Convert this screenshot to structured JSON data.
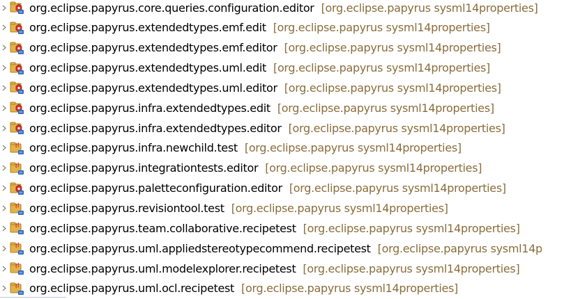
{
  "colors": {
    "name": "#000000",
    "decoration": "#8a6d3b",
    "twisty": "#808080",
    "folder": "#e2b24a",
    "folder_dark": "#b07d1c",
    "badge": "#2c62b8",
    "badge_light": "#6aa0e6",
    "plugin_red": "#d9342b"
  },
  "tree": {
    "items": [
      {
        "name": "org.eclipse.papyrus.core.queries.configuration.editor",
        "decoration": "[org.eclipse.papyrus sysml14properties]",
        "icon": "plugin-project-icon"
      },
      {
        "name": "org.eclipse.papyrus.extendedtypes.emf.edit",
        "decoration": "[org.eclipse.papyrus sysml14properties]",
        "icon": "plugin-project-icon"
      },
      {
        "name": "org.eclipse.papyrus.extendedtypes.emf.editor",
        "decoration": "[org.eclipse.papyrus sysml14properties]",
        "icon": "plugin-project-icon"
      },
      {
        "name": "org.eclipse.papyrus.extendedtypes.uml.edit",
        "decoration": "[org.eclipse.papyrus sysml14properties]",
        "icon": "plugin-project-icon"
      },
      {
        "name": "org.eclipse.papyrus.extendedtypes.uml.editor",
        "decoration": "[org.eclipse.papyrus sysml14properties]",
        "icon": "plugin-project-icon"
      },
      {
        "name": "org.eclipse.papyrus.infra.extendedtypes.edit",
        "decoration": "[org.eclipse.papyrus sysml14properties]",
        "icon": "plugin-project-icon"
      },
      {
        "name": "org.eclipse.papyrus.infra.extendedtypes.editor",
        "decoration": "[org.eclipse.papyrus sysml14properties]",
        "icon": "plugin-project-icon"
      },
      {
        "name": "org.eclipse.papyrus.infra.newchild.test",
        "decoration": "[org.eclipse.papyrus sysml14properties]",
        "icon": "java-project-icon"
      },
      {
        "name": "org.eclipse.papyrus.integrationtests.editor",
        "decoration": "[org.eclipse.papyrus sysml14properties]",
        "icon": "java-project-icon"
      },
      {
        "name": "org.eclipse.papyrus.paletteconfiguration.editor",
        "decoration": "[org.eclipse.papyrus sysml14properties]",
        "icon": "plugin-project-icon"
      },
      {
        "name": "org.eclipse.papyrus.revisiontool.test",
        "decoration": "[org.eclipse.papyrus sysml14properties]",
        "icon": "java-project-icon"
      },
      {
        "name": "org.eclipse.papyrus.team.collaborative.recipetest",
        "decoration": "[org.eclipse.papyrus sysml14properties]",
        "icon": "java-project-icon"
      },
      {
        "name": "org.eclipse.papyrus.uml.appliedstereotypecommend.recipetest",
        "decoration": "[org.eclipse.papyrus sysml14p",
        "icon": "java-project-icon"
      },
      {
        "name": "org.eclipse.papyrus.uml.modelexplorer.recipetest",
        "decoration": "[org.eclipse.papyrus sysml14properties]",
        "icon": "java-project-icon"
      },
      {
        "name": "org.eclipse.papyrus.uml.ocl.recipetest",
        "decoration": "[org.eclipse.papyrus sysml14properties]",
        "icon": "java-project-icon"
      }
    ]
  }
}
